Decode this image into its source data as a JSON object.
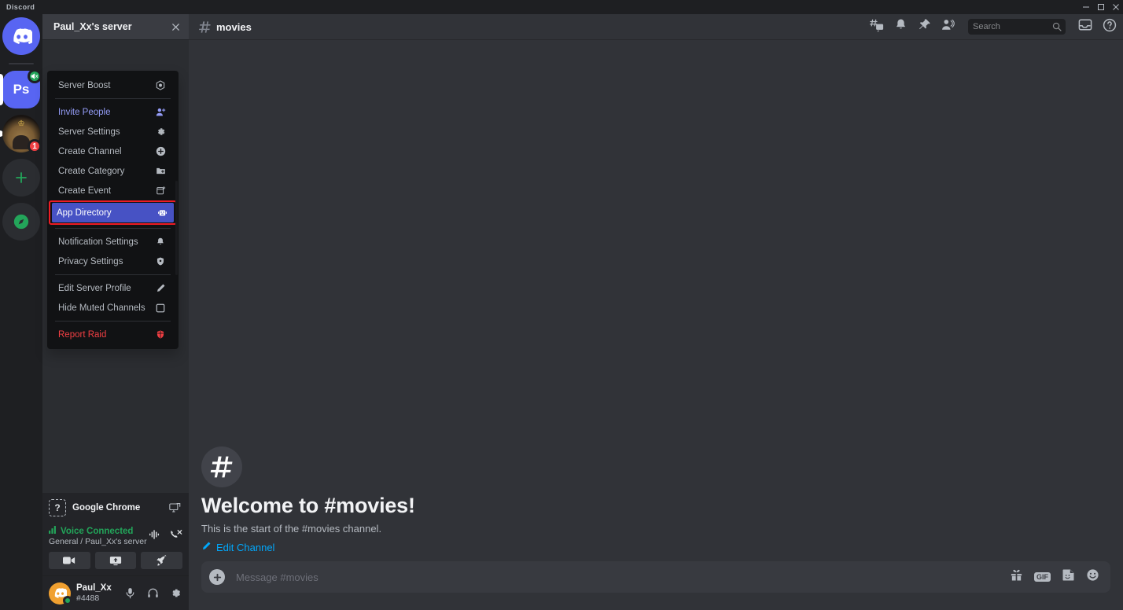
{
  "window": {
    "app_title": "Discord",
    "controls": [
      "minimize",
      "maximize",
      "close"
    ]
  },
  "rail": {
    "home_tooltip": "Discord",
    "servers": [
      {
        "name": "Ps",
        "label": "Ps",
        "badge": "",
        "muted": true,
        "active": true
      },
      {
        "name": "Paul_Xx's server",
        "label": "",
        "badge": "1",
        "muted": false,
        "active": false
      }
    ],
    "add_server_label": "+",
    "explore_label": "Explore Public Servers"
  },
  "sidebar": {
    "server_name": "Paul_Xx's server",
    "close_label": "Close",
    "activity": {
      "app_name": "Google Chrome",
      "icon_glyph": "?",
      "action": "screen-share"
    },
    "voice": {
      "status": "Voice Connected",
      "location": "General / Paul_Xx's server",
      "buttons": [
        "camera",
        "screen-share",
        "activity-rocket"
      ],
      "icons": [
        "signal-noise",
        "disconnect-call"
      ]
    },
    "user": {
      "name": "Paul_Xx",
      "tag": "#4488",
      "status": "online",
      "controls": [
        "microphone",
        "headphones",
        "settings"
      ]
    }
  },
  "context_menu": {
    "items": [
      {
        "label": "Server Boost",
        "icon": "boost-icon",
        "style": "normal",
        "separator_after": true
      },
      {
        "label": "Invite People",
        "icon": "invite-person-icon",
        "style": "invite",
        "separator_after": false
      },
      {
        "label": "Server Settings",
        "icon": "gear-icon",
        "style": "normal",
        "separator_after": false
      },
      {
        "label": "Create Channel",
        "icon": "plus-circle-icon",
        "style": "normal",
        "separator_after": false
      },
      {
        "label": "Create Category",
        "icon": "folder-plus-icon",
        "style": "normal",
        "separator_after": false
      },
      {
        "label": "Create Event",
        "icon": "calendar-plus-icon",
        "style": "normal",
        "separator_after": false
      },
      {
        "label": "App Directory",
        "icon": "robot-icon",
        "style": "highlight",
        "separator_after": true
      },
      {
        "label": "Notification Settings",
        "icon": "bell-icon",
        "style": "normal",
        "separator_after": false
      },
      {
        "label": "Privacy Settings",
        "icon": "shield-icon",
        "style": "normal",
        "separator_after": true
      },
      {
        "label": "Edit Server Profile",
        "icon": "pencil-icon",
        "style": "normal",
        "separator_after": false
      },
      {
        "label": "Hide Muted Channels",
        "icon": "checkbox-icon",
        "style": "normal",
        "separator_after": true
      },
      {
        "label": "Report Raid",
        "icon": "shield-danger-icon",
        "style": "danger",
        "separator_after": false
      }
    ],
    "highlight_fill": "#4752c4",
    "highlight_border": "#ee1c24"
  },
  "main": {
    "channel_name": "movies",
    "header_icons": [
      "threads-icon",
      "bell-icon",
      "pin-icon",
      "members-icon"
    ],
    "search": {
      "placeholder": "Search",
      "value": ""
    },
    "header_right_icons": [
      "inbox-icon",
      "help-icon"
    ],
    "welcome": {
      "title": "Welcome to #movies!",
      "subtitle": "This is the start of the #movies channel.",
      "edit_link": "Edit Channel"
    },
    "composer": {
      "placeholder": "Message #movies",
      "value": "",
      "icons": [
        "gift-icon",
        "gif-icon",
        "sticker-icon",
        "emoji-icon"
      ],
      "gif_label": "GIF"
    }
  },
  "colors": {
    "accent": "#5865f2",
    "brand_blurple": "#4752c4",
    "online_green": "#23a55a",
    "danger_red": "#f23f43",
    "link_blue": "#00a8fc",
    "highlight_red": "#ee1c24"
  }
}
